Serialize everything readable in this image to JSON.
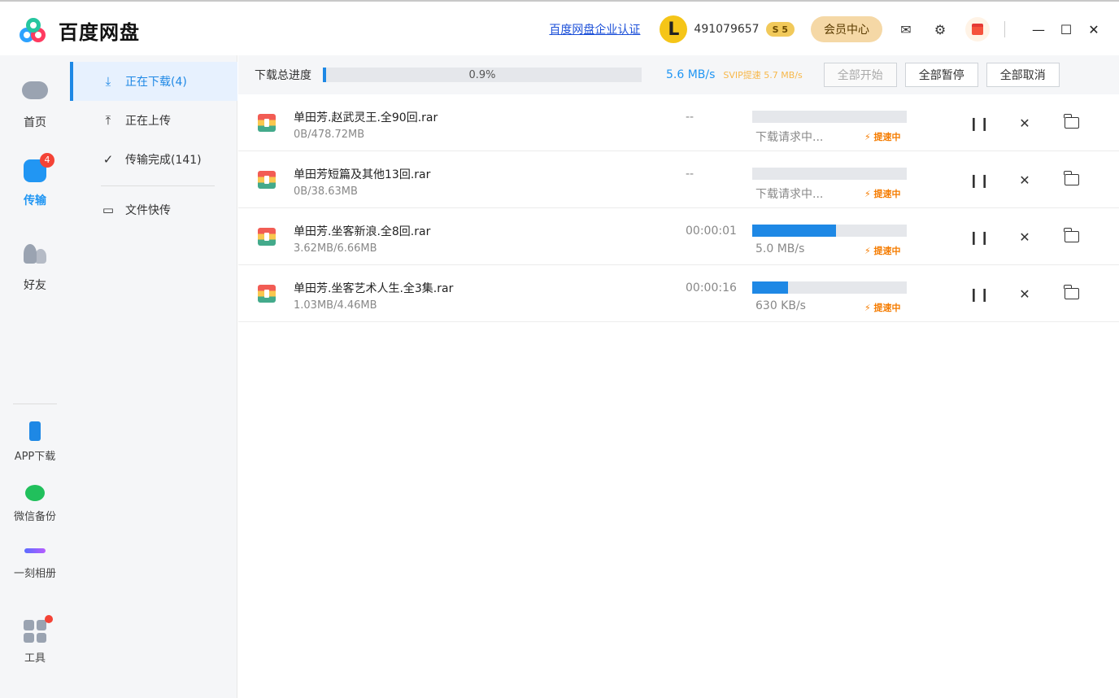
{
  "app": {
    "name": "百度网盘"
  },
  "titlebar": {
    "enterprise_link": "百度网盘企业认证",
    "avatar_letter": "L",
    "user_id": "491079657",
    "svip_badge": "S 5",
    "member_center": "会员中心"
  },
  "rail": {
    "home": "首页",
    "transfer": "传输",
    "transfer_badge": "4",
    "friends": "好友",
    "app_download": "APP下载",
    "wechat_backup": "微信备份",
    "moment_album": "一刻相册",
    "tools": "工具"
  },
  "submenu": {
    "downloading": "正在下载(4)",
    "uploading": "正在上传",
    "completed": "传输完成(141)",
    "quick_transfer": "文件快传"
  },
  "toolbar": {
    "total_progress_label": "下载总进度",
    "total_progress_text": "0.9%",
    "total_progress": 0.9,
    "speed": "5.6 MB/s",
    "svip_speed": "SVIP提速 5.7 MB/s",
    "start_all": "全部开始",
    "pause_all": "全部暂停",
    "cancel_all": "全部取消"
  },
  "tasks": [
    {
      "name": "单田芳.赵武灵王.全90回.rar",
      "size": "0B/478.72MB",
      "time": "--",
      "status": "下载请求中...",
      "boost": "⚡ 提速中",
      "progress": 0
    },
    {
      "name": "单田芳短篇及其他13回.rar",
      "size": "0B/38.63MB",
      "time": "--",
      "status": "下载请求中...",
      "boost": "⚡ 提速中",
      "progress": 0
    },
    {
      "name": "单田芳.坐客新浪.全8回.rar",
      "size": "3.62MB/6.66MB",
      "time": "00:00:01",
      "status": "5.0 MB/s",
      "boost": "⚡ 提速中",
      "progress": 54
    },
    {
      "name": "单田芳.坐客艺术人生.全3集.rar",
      "size": "1.03MB/4.46MB",
      "time": "00:00:16",
      "status": "630 KB/s",
      "boost": "⚡ 提速中",
      "progress": 23
    }
  ],
  "colors": {
    "accent": "#1e88e5",
    "boost": "#f57c00",
    "badge": "#f44336"
  }
}
